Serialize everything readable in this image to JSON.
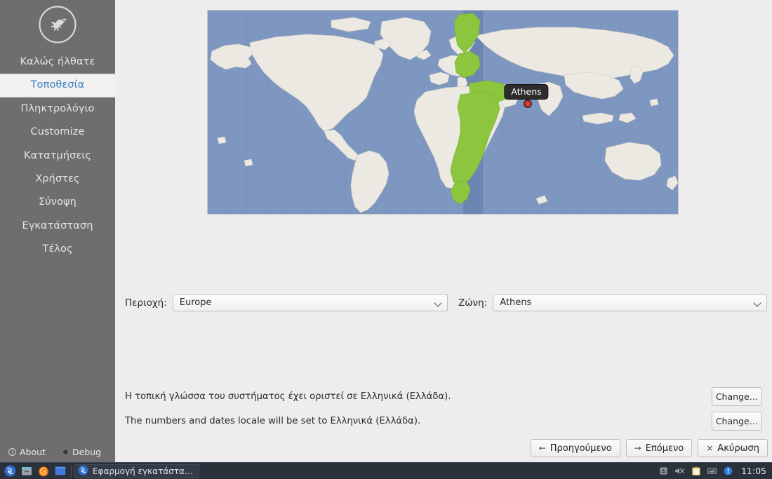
{
  "window": {
    "title": "Εφαρμογή εγκατάστα…"
  },
  "sidebar": {
    "logo_icon": "dove-logo-icon",
    "items": [
      {
        "label": "Καλώς ήλθατε",
        "selected": false
      },
      {
        "label": "Τοποθεσία",
        "selected": true
      },
      {
        "label": "Πληκτρολόγιο",
        "selected": false
      },
      {
        "label": "Customize",
        "selected": false
      },
      {
        "label": "Κατατμήσεις",
        "selected": false
      },
      {
        "label": "Χρήστες",
        "selected": false
      },
      {
        "label": "Σύνοψη",
        "selected": false
      },
      {
        "label": "Εγκατάσταση",
        "selected": false
      },
      {
        "label": "Τέλος",
        "selected": false
      }
    ],
    "footer": {
      "about_label": "About",
      "about_icon": "info-circle-icon",
      "debug_label": "Debug",
      "debug_icon": "debug-dot-icon"
    },
    "colors": {
      "background": "#6e6e6e",
      "selected_background": "#f1f1f1",
      "selected_text": "#3d7fbf",
      "text": "#e4e4e4"
    }
  },
  "map": {
    "tooltip_label": "Athens",
    "marker_icon": "location-marker-icon",
    "colors": {
      "ocean": "#7e97c0",
      "land": "#ece9e3",
      "selected_zone": "#8cc63f",
      "selected_band": "#6c86b4",
      "tooltip_bg": "#2d2d2d",
      "marker": "#e23b2e"
    }
  },
  "selectors": {
    "region": {
      "label": "Περιοχή:",
      "value": "Europe",
      "chevron_icon": "chevron-down-icon"
    },
    "zone": {
      "label": "Ζώνη:",
      "value": "Athens",
      "chevron_icon": "chevron-down-icon"
    }
  },
  "locale": {
    "rows": [
      {
        "text": "Η τοπική γλώσσα του συστήματος έχει οριστεί σε Ελληνικά (Ελλάδα).",
        "button": "Change…"
      },
      {
        "text": "The numbers and dates locale will be set to Ελληνικά (Ελλάδα).",
        "button": "Change…"
      }
    ]
  },
  "navigation": {
    "back": {
      "label": "Προηγούμενο",
      "glyph": "←",
      "icon": "arrow-left-icon"
    },
    "next": {
      "label": "Επόμενο",
      "glyph": "→",
      "icon": "arrow-right-icon"
    },
    "cancel": {
      "label": "Ακύρωση",
      "glyph": "×",
      "icon": "close-icon"
    }
  },
  "taskbar": {
    "launchers": [
      {
        "name": "start-menu-icon"
      },
      {
        "name": "file-manager-icon"
      },
      {
        "name": "firefox-icon"
      },
      {
        "name": "terminal-icon"
      }
    ],
    "task": {
      "icon": "installer-app-icon",
      "label": "Εφαρμογή εγκατάστα…"
    },
    "tray": [
      {
        "name": "eject-icon"
      },
      {
        "name": "volume-muted-icon"
      },
      {
        "name": "clipboard-icon"
      },
      {
        "name": "network-icon"
      },
      {
        "name": "update-alert-icon"
      }
    ],
    "clock": "11:05",
    "colors": {
      "background": "#2b313a",
      "text": "#e3e7ee"
    }
  }
}
